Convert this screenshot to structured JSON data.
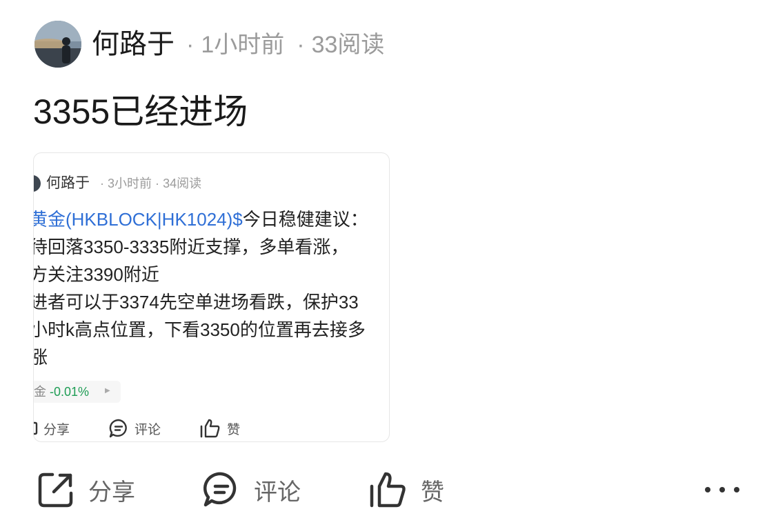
{
  "post": {
    "author": "何路于",
    "time": "1小时前",
    "reads": "33阅读",
    "separator": "·",
    "text": "3355已经进场"
  },
  "embedded": {
    "author": "何路于",
    "time": "3小时前",
    "reads": "34阅读",
    "separator": "·",
    "lines": [
      {
        "link": "黄金(HKBLOCK|HK1024)$",
        "text": "今日稳健建议："
      },
      {
        "link": "",
        "text": "待回落3350-3335附近支撑，多单看涨，"
      },
      {
        "link": "",
        "text": "方关注3390附近"
      },
      {
        "link": "",
        "text": "进者可以于3374先空单进场看跌，保护33"
      },
      {
        "link": "",
        "text": "小时k高点位置，下看3350的位置再去接多"
      },
      {
        "link": "",
        "text": "涨"
      }
    ],
    "quote": {
      "name": "金",
      "change": "-0.01%"
    },
    "actions": {
      "share": "分享",
      "comment": "评论",
      "like": "赞"
    }
  },
  "actions": {
    "share": "分享",
    "comment": "评论",
    "like": "赞"
  },
  "colors": {
    "link": "#2f6fd6",
    "positive_green": "#1f9d55",
    "meta_gray": "#9b9b9b"
  },
  "icons": [
    "share-icon",
    "comment-icon",
    "like-icon",
    "more-icon"
  ]
}
